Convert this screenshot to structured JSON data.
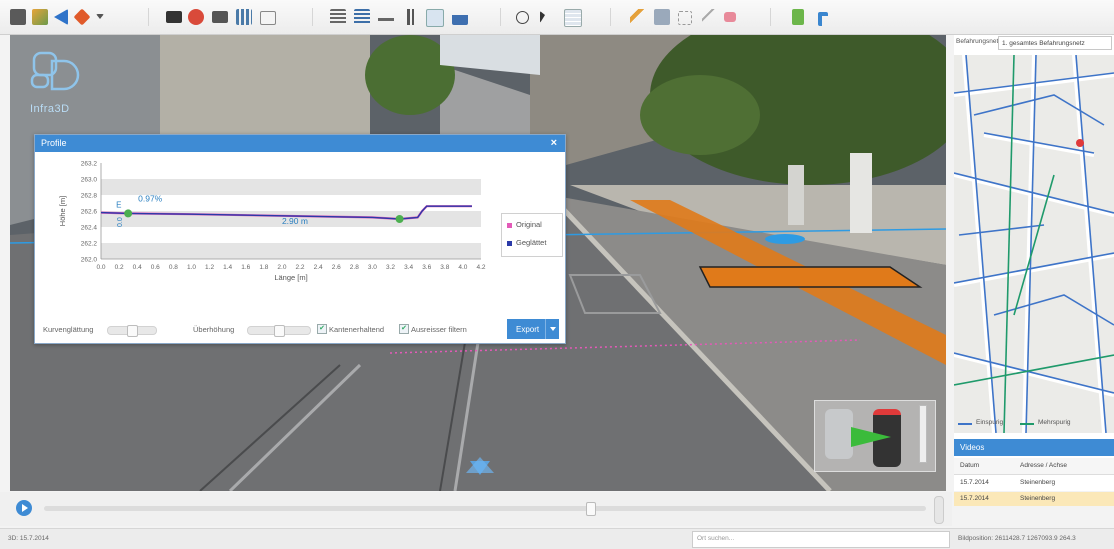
{
  "toolbar": {
    "icons": [
      "layers-icon",
      "terrain-icon",
      "back-arrow-icon",
      "compass-icon",
      "dropdown-caret-icon",
      "camera-icon",
      "marker-icon",
      "camera-pair-icon",
      "grid-icon",
      "book-icon",
      "ruler-icon",
      "ruler-grid-icon",
      "ruler-flat-icon",
      "height-icon",
      "profile-chart-icon",
      "cross-section-icon",
      "info-icon",
      "cursor-icon",
      "table-icon",
      "pencil-icon",
      "save-icon",
      "polyline-icon",
      "brush-icon",
      "eraser-icon",
      "document-icon",
      "export-arrow-icon"
    ],
    "accent": "#3e8bd4"
  },
  "logo": {
    "name": "Infra3D"
  },
  "profile": {
    "title": "Profile",
    "close": "×",
    "y_axis_title": "Höhe [m]",
    "x_axis_title": "Länge [m]",
    "marker_e": "E",
    "marker_zero": "0.0",
    "slope": "0.97%",
    "distance": "2.90 m",
    "legend": [
      {
        "label": "Original",
        "color": "#e35ab8"
      },
      {
        "label": "Geglättet",
        "color": "#2b3aa8"
      }
    ],
    "controls": {
      "smoothing_label": "Kurvenglättung",
      "exaggeration_label": "Überhöhung",
      "edge_checkbox": "Kantenerhaltend",
      "outlier_checkbox": "Ausreisser filtern",
      "export_button": "Export"
    }
  },
  "chart_data": {
    "type": "line",
    "title": "",
    "xlabel": "Länge [m]",
    "ylabel": "Höhe [m]",
    "xlim": [
      0.0,
      4.2
    ],
    "ylim": [
      262.0,
      263.2
    ],
    "x_ticks": [
      "0.0",
      "0.2",
      "0.4",
      "0.6",
      "0.8",
      "1.0",
      "1.2",
      "1.4",
      "1.6",
      "1.8",
      "2.0",
      "2.2",
      "2.4",
      "2.6",
      "2.8",
      "3.0",
      "3.2",
      "3.4",
      "3.6",
      "3.8",
      "4.0",
      "4.2"
    ],
    "y_ticks": [
      "262.0",
      "262.2",
      "262.4",
      "262.6",
      "262.8",
      "263.0",
      "263.2"
    ],
    "series": [
      {
        "name": "Original",
        "color": "#e35ab8",
        "x": [
          0.0,
          0.3,
          1.0,
          2.0,
          3.0,
          3.3,
          3.5,
          3.55,
          3.6,
          4.0,
          4.1
        ],
        "y": [
          262.58,
          262.57,
          262.56,
          262.54,
          262.52,
          262.5,
          262.52,
          262.6,
          262.66,
          262.66,
          262.66
        ]
      },
      {
        "name": "Geglättet",
        "color": "#2b3aa8",
        "x": [
          0.0,
          0.3,
          1.0,
          2.0,
          3.0,
          3.3,
          3.5,
          3.55,
          3.6,
          4.0,
          4.1
        ],
        "y": [
          262.58,
          262.57,
          262.56,
          262.54,
          262.52,
          262.5,
          262.52,
          262.6,
          262.66,
          262.66,
          262.66
        ]
      }
    ],
    "points": [
      {
        "x": 0.3,
        "y": 262.57
      },
      {
        "x": 3.3,
        "y": 262.5
      }
    ],
    "grid": true
  },
  "sidebar": {
    "network_label": "Befahrungsnetz:",
    "network_value": "1. gesamtes Befahrungsnetz",
    "legend_einspurig": "Einspurig",
    "legend_mehrspurig": "Mehrspurig",
    "videos_title": "Videos",
    "videos_columns": [
      "Datum",
      "Adresse / Achse"
    ],
    "videos_rows": [
      {
        "date": "15.7.2014",
        "address": "Steinenberg"
      },
      {
        "date": "15.7.2014",
        "address": "Steinenberg"
      }
    ]
  },
  "statusbar": {
    "mode": "3D: 15.7.2014",
    "search_placeholder": "Ort suchen...",
    "position": "Bildposition: 2611428.7 1267093.9 264.3"
  }
}
